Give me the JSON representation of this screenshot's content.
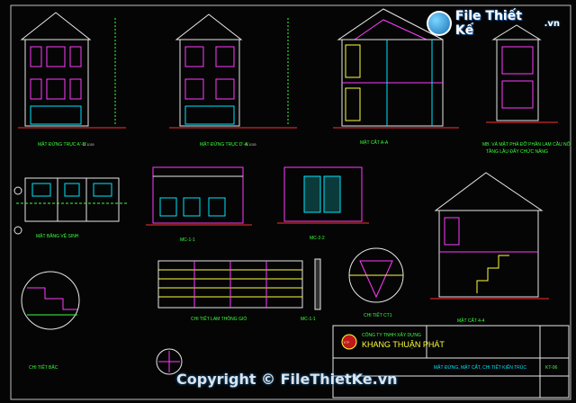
{
  "brand": {
    "name": "File Thiết Kế",
    "tld": ".vn",
    "copyright": "Copyright © FileThietKe.vn"
  },
  "labels": {
    "elev1": "MẶT ĐỨNG TRỤC A'-D'",
    "elev2": "MẶT ĐỨNG TRỤC D'-A'",
    "sec_aa": "MẶT CẮT A-A",
    "elev_right": "MB. VÀ MẶT PHẢ ĐỠ PHẦN LAM CẦU NỐI",
    "elev_right2": "TẦNG LẦU ĐẤY CHỨC NĂNG",
    "plan": "MẶT BẰNG VỆ SINH",
    "mc11": "MC-1-1",
    "mc22": "MC-2-2",
    "mc11b": "MC-1-1",
    "lam": "CHI TIẾT LAM THÔNG GIÓ",
    "ct01": "CHI TIẾT CT1",
    "sec_44": "MẶT CẮT 4-4",
    "detail_left": "CHI TIẾT BẬC",
    "detail_stair": "CHI TIẾT BẬC"
  },
  "scale": "TL 1/100",
  "title_block": {
    "company": "CÔNG TY TNHH XÂY DỰNG",
    "company_name": "KHANG THUẬN PHÁT",
    "drawing": "MẶT ĐỨNG, MẶT CẮT, CHI TIẾT KIẾN TRÚC",
    "sheet": "KT-06"
  },
  "colors": {
    "green": "#3cff3c",
    "cyan": "#00e5ff",
    "magenta": "#ff3cff",
    "yellow": "#ffff3c",
    "red": "#ff3030",
    "white": "#e8e8e8"
  }
}
